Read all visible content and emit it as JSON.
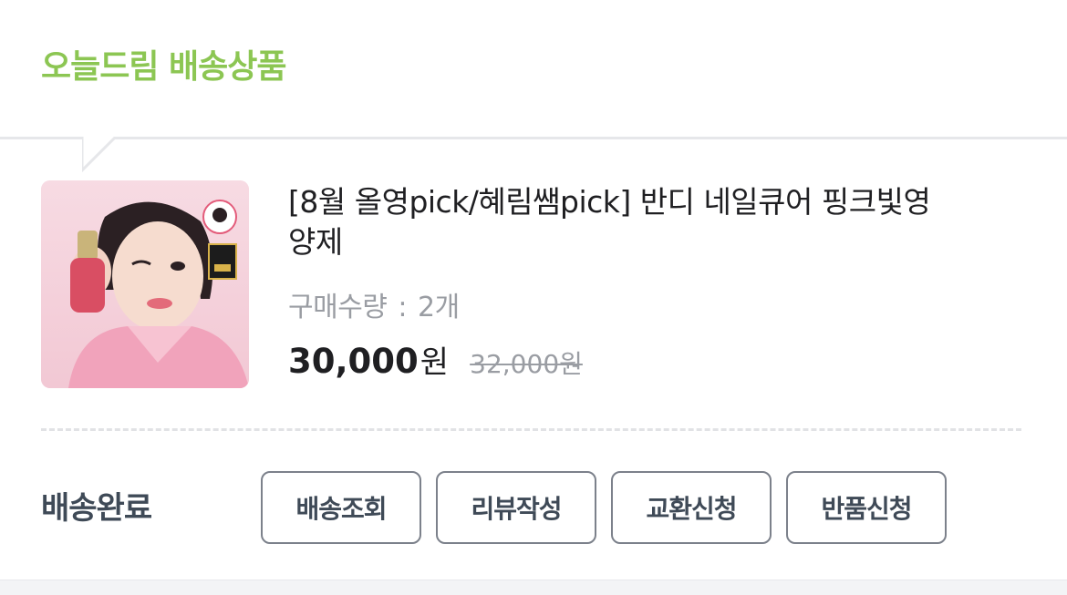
{
  "section": {
    "title": "오늘드림 배송상품"
  },
  "product": {
    "title": "[8월 올영pick/혜림쌤pick] 반디 네일큐어 핑크빛영양제",
    "quantity_label": "구매수량",
    "quantity_sep": ":",
    "quantity_value": "2개",
    "price": "30,000",
    "price_unit": "원",
    "original_price": "32,000원",
    "image_alt": "product-photo"
  },
  "order": {
    "status": "배송완료",
    "buttons": [
      "배송조회",
      "리뷰작성",
      "교환신청",
      "반품신청"
    ]
  },
  "colors": {
    "accent_green": "#8cc653",
    "text_dark": "#1f1f22",
    "muted": "#9a9da3",
    "button_border": "#7c818b"
  }
}
